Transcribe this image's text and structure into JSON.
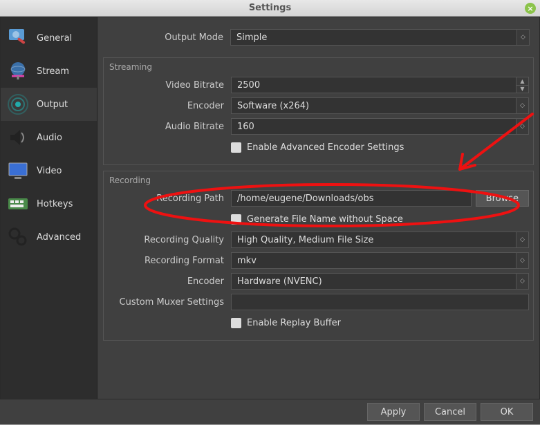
{
  "title": "Settings",
  "sidebar": {
    "items": [
      {
        "label": "General"
      },
      {
        "label": "Stream"
      },
      {
        "label": "Output"
      },
      {
        "label": "Audio"
      },
      {
        "label": "Video"
      },
      {
        "label": "Hotkeys"
      },
      {
        "label": "Advanced"
      }
    ]
  },
  "output": {
    "output_mode_label": "Output Mode",
    "output_mode_value": "Simple"
  },
  "streaming": {
    "section": "Streaming",
    "video_bitrate_label": "Video Bitrate",
    "video_bitrate_value": "2500",
    "encoder_label": "Encoder",
    "encoder_value": "Software (x264)",
    "audio_bitrate_label": "Audio Bitrate",
    "audio_bitrate_value": "160",
    "enable_adv_label": "Enable Advanced Encoder Settings"
  },
  "recording": {
    "section": "Recording",
    "path_label": "Recording Path",
    "path_value": "/home/eugene/Downloads/obs",
    "browse_label": "Browse",
    "gen_filename_label": "Generate File Name without Space",
    "quality_label": "Recording Quality",
    "quality_value": "High Quality, Medium File Size",
    "format_label": "Recording Format",
    "format_value": "mkv",
    "rec_encoder_label": "Encoder",
    "rec_encoder_value": "Hardware (NVENC)",
    "muxer_label": "Custom Muxer Settings",
    "muxer_value": "",
    "replay_label": "Enable Replay Buffer"
  },
  "footer": {
    "apply": "Apply",
    "cancel": "Cancel",
    "ok": "OK"
  }
}
